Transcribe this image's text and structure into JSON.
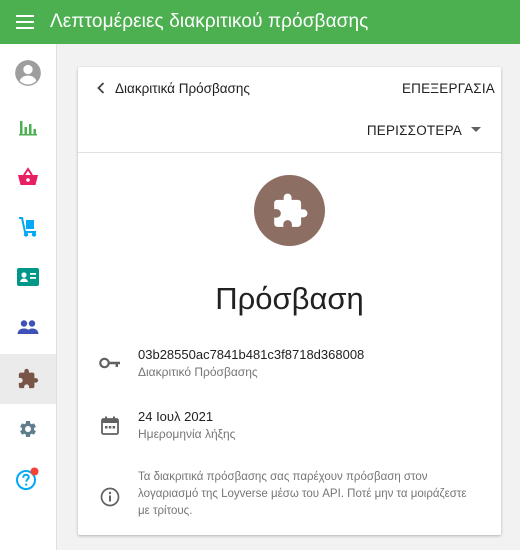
{
  "app": {
    "title": "Λεπτομέρειες διακριτικού πρόσβασης",
    "accent": "#4caf50"
  },
  "sidebar": {
    "items": [
      {
        "name": "account",
        "icon": "account-circle-icon",
        "active": false
      },
      {
        "name": "reports",
        "icon": "bar-chart-icon",
        "active": false
      },
      {
        "name": "items",
        "icon": "basket-icon",
        "active": false
      },
      {
        "name": "inventory",
        "icon": "dolly-icon",
        "active": false
      },
      {
        "name": "customers",
        "icon": "id-card-icon",
        "active": false
      },
      {
        "name": "employees",
        "icon": "people-icon",
        "active": false
      },
      {
        "name": "integrations",
        "icon": "puzzle-icon",
        "active": true
      },
      {
        "name": "settings",
        "icon": "gear-icon",
        "active": false
      },
      {
        "name": "help",
        "icon": "help-icon",
        "active": false,
        "notification_dot": true
      }
    ]
  },
  "card": {
    "back_label": "Διακριτικά Πρόσβασης",
    "edit_label": "ΕΠΕΞΕΡΓΑΣΙΑ",
    "more_label": "ΠΕΡΙΣΣΟΤΕΡΑ",
    "token_name": "Πρόσβαση",
    "token": {
      "value": "03b28550ac7841b481c3f8718d368008",
      "label": "Διακριτικό Πρόσβασης"
    },
    "expiry": {
      "value": "24 Ιουλ 2021",
      "label": "Ημερομηνία λήξης"
    },
    "note": "Τα διακριτικά πρόσβασης σας παρέχουν πρόσβαση στον λογαριασμό της Loyverse μέσω του API. Ποτέ μην τα μοιράζεστε με τρίτους."
  }
}
